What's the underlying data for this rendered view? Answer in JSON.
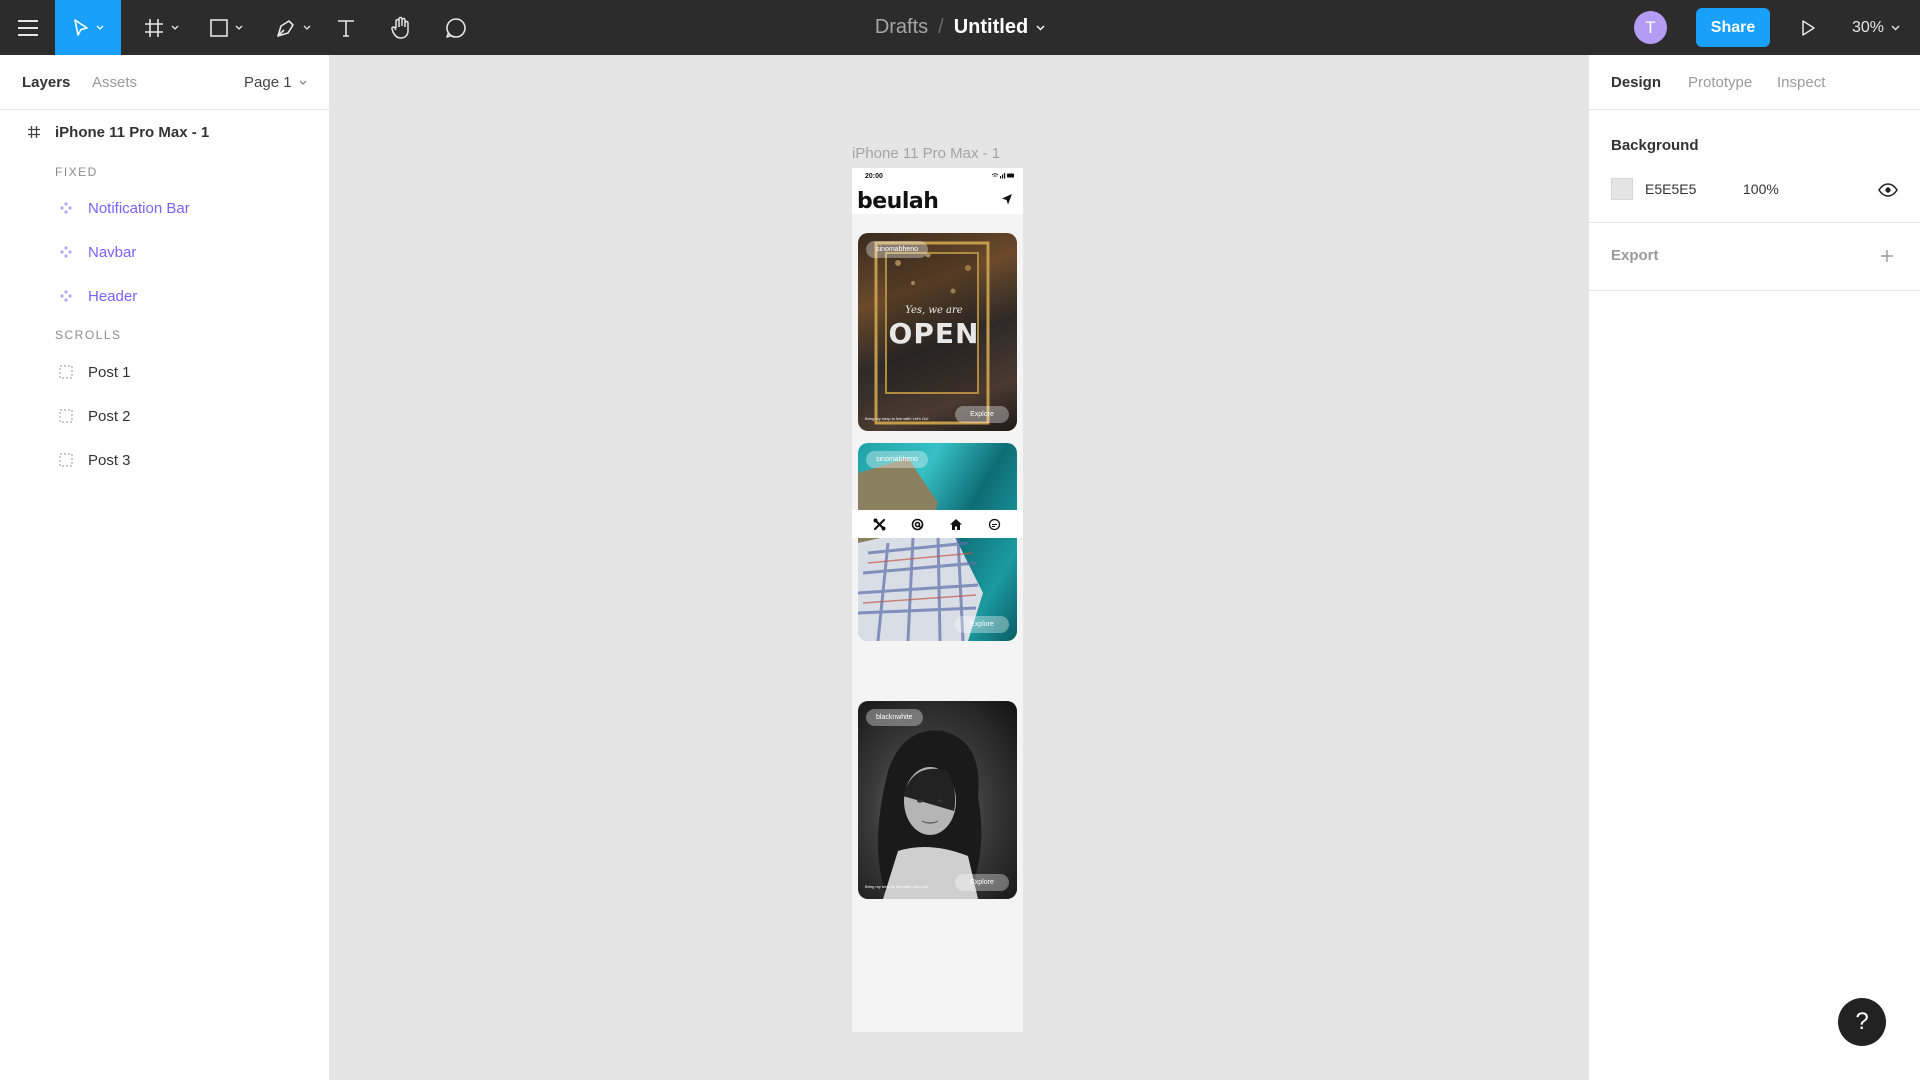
{
  "toolbar": {
    "tools": [
      {
        "name": "menu-icon"
      },
      {
        "name": "move-tool-icon"
      },
      {
        "name": "frame-tool-icon"
      },
      {
        "name": "shape-tool-icon"
      },
      {
        "name": "pen-tool-icon"
      },
      {
        "name": "text-tool-icon"
      },
      {
        "name": "hand-tool-icon"
      },
      {
        "name": "comment-tool-icon"
      }
    ],
    "breadcrumb_root": "Drafts",
    "breadcrumb_sep": "/",
    "file_title": "Untitled",
    "avatar_initial": "T",
    "share_label": "Share",
    "zoom_label": "30%",
    "accent_color": "#18a0fb"
  },
  "left_panel": {
    "tab_layers": "Layers",
    "tab_assets": "Assets",
    "page_label": "Page 1",
    "frame_name": "iPhone 11 Pro Max - 1",
    "section_fixed": "FIXED",
    "fixed_layers": [
      "Notification Bar",
      "Navbar",
      "Header"
    ],
    "section_scrolls": "SCROLLS",
    "scroll_layers": [
      "Post 1",
      "Post 2",
      "Post 3"
    ],
    "component_color": "#7b61ff"
  },
  "canvas": {
    "background_color": "#e5e5e5",
    "frame_label": "iPhone 11 Pro Max - 1",
    "phone": {
      "status_time": "20:00",
      "brand": "beulah",
      "posts": [
        {
          "tag": "sinomabheno",
          "caption": "Bring my shop to live with! Let's Go!",
          "button": "Explore"
        },
        {
          "tag": "sinomabheno",
          "caption": "",
          "button": "Explore"
        },
        {
          "tag": "blacknwhite",
          "caption": "Bring my shop to live with! Let's Go!",
          "button": "Explore"
        }
      ],
      "nav_icons": [
        "tools-icon",
        "at-icon",
        "home-icon",
        "chat-icon"
      ]
    }
  },
  "right_panel": {
    "tab_design": "Design",
    "tab_prototype": "Prototype",
    "tab_inspect": "Inspect",
    "background_title": "Background",
    "background_hex": "E5E5E5",
    "background_opacity": "100%",
    "export_title": "Export"
  },
  "help_label": "?"
}
